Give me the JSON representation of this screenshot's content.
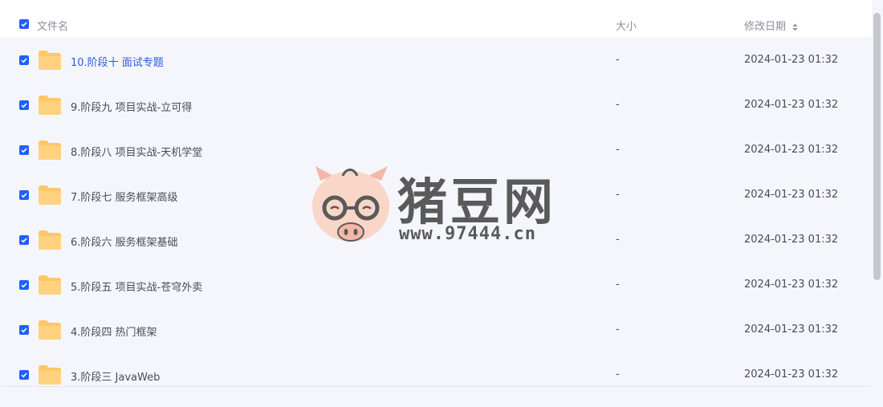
{
  "header": {
    "name_label": "文件名",
    "size_label": "大小",
    "date_label": "修改日期"
  },
  "files": [
    {
      "name": "10.阶段十 面试专题",
      "size": "-",
      "date": "2024-01-23 01:32"
    },
    {
      "name": "9.阶段九 项目实战-立可得",
      "size": "-",
      "date": "2024-01-23 01:32"
    },
    {
      "name": "8.阶段八 项目实战-天机学堂",
      "size": "-",
      "date": "2024-01-23 01:32"
    },
    {
      "name": "7.阶段七 服务框架高级",
      "size": "-",
      "date": "2024-01-23 01:32"
    },
    {
      "name": "6.阶段六 服务框架基础",
      "size": "-",
      "date": "2024-01-23 01:32"
    },
    {
      "name": "5.阶段五 项目实战-苍穹外卖",
      "size": "-",
      "date": "2024-01-23 01:32"
    },
    {
      "name": "4.阶段四 热门框架",
      "size": "-",
      "date": "2024-01-23 01:32"
    },
    {
      "name": "3.阶段三 JavaWeb",
      "size": "-",
      "date": "2024-01-23 01:32"
    }
  ],
  "watermark": {
    "title": "猪豆网",
    "url": "www.97444.cn"
  },
  "icons": {
    "folder": "folder-icon",
    "checkbox": "checkbox-checked-icon",
    "sort": "sort-icon"
  },
  "colors": {
    "accent": "#1f5fff",
    "active_link": "#2b5ae6",
    "folder": "#ffc766"
  }
}
